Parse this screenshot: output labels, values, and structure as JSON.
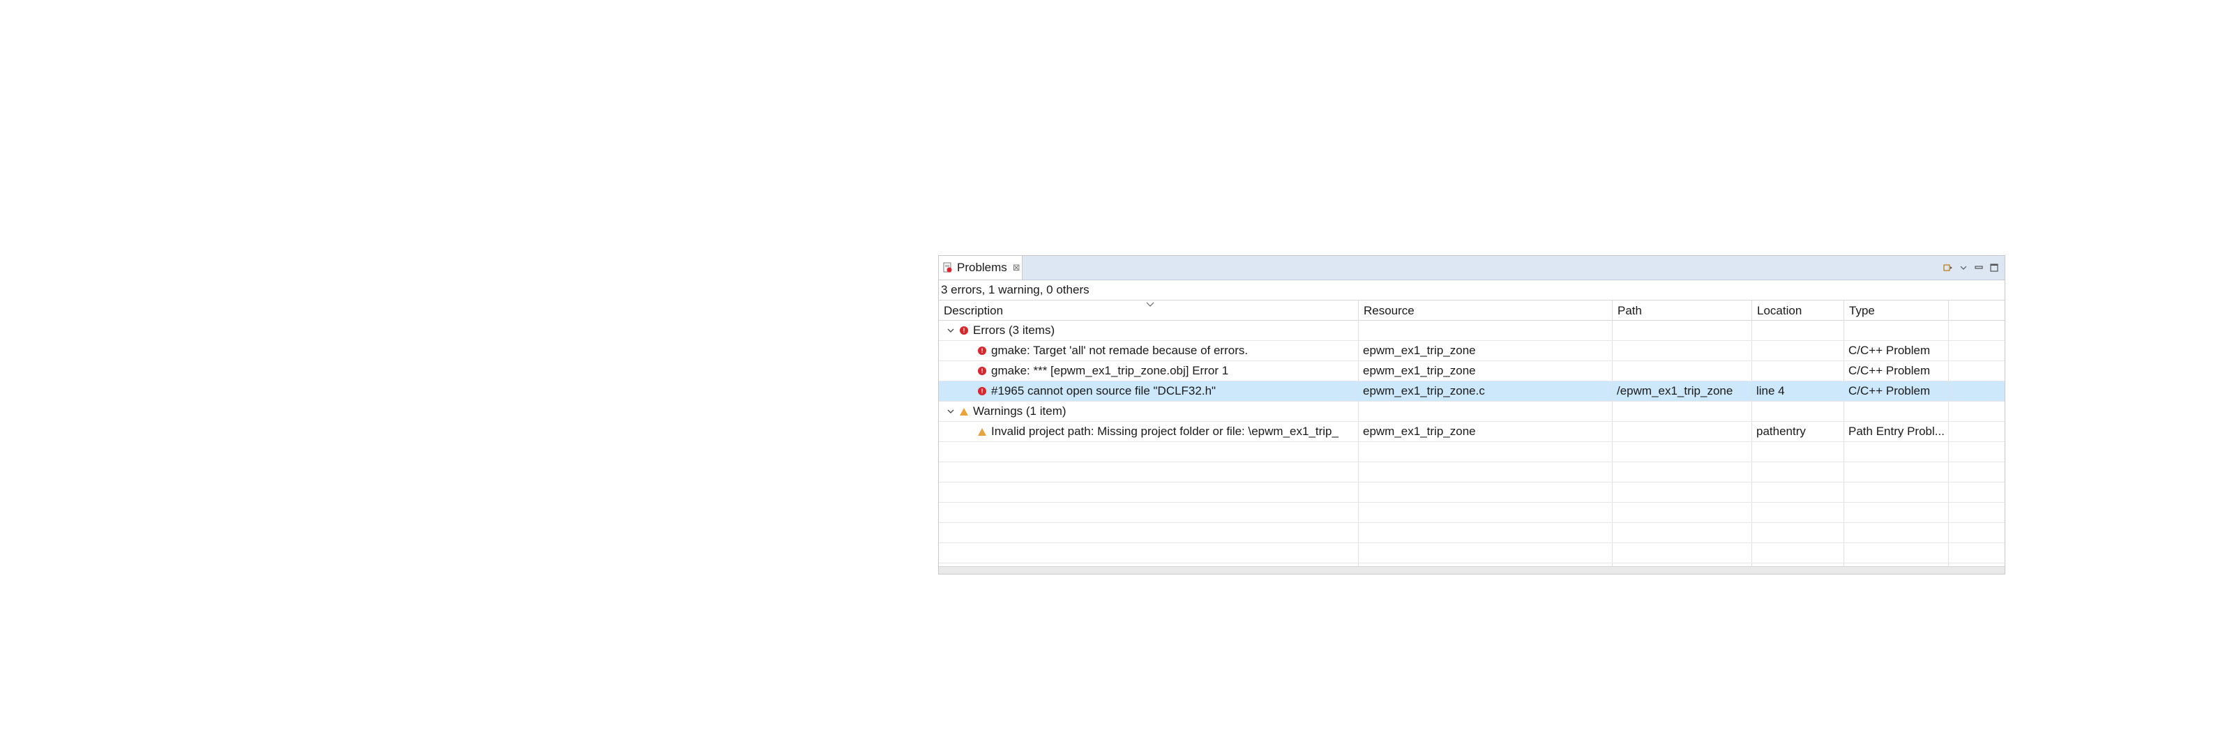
{
  "view": {
    "tab_label": "Problems",
    "tab_close": "⊠",
    "summary": "3 errors, 1 warning, 0 others"
  },
  "columns": [
    "Description",
    "Resource",
    "Path",
    "Location",
    "Type"
  ],
  "groups": [
    {
      "label": "Errors (3 items)",
      "kind": "error",
      "items": [
        {
          "description": "gmake: Target 'all' not remade because of errors.",
          "resource": "epwm_ex1_trip_zone",
          "path": "",
          "location": "",
          "type": "C/C++ Problem"
        },
        {
          "description": "gmake: *** [epwm_ex1_trip_zone.obj] Error 1",
          "resource": "epwm_ex1_trip_zone",
          "path": "",
          "location": "",
          "type": "C/C++ Problem"
        },
        {
          "description": "#1965 cannot open source file \"DCLF32.h\"",
          "resource": "epwm_ex1_trip_zone.c",
          "path": "/epwm_ex1_trip_zone",
          "location": "line 4",
          "type": "C/C++ Problem"
        }
      ]
    },
    {
      "label": "Warnings (1 item)",
      "kind": "warning",
      "items": [
        {
          "description": "Invalid project path: Missing project folder or file: \\epwm_ex1_trip_",
          "resource": "epwm_ex1_trip_zone",
          "path": "",
          "location": "pathentry",
          "type": "Path Entry Probl..."
        }
      ]
    }
  ],
  "colors": {
    "error": "#d9252c",
    "warning": "#e8a33d",
    "selection": "#cde8fb",
    "tabbar": "#dde6f3"
  },
  "icons": {
    "tab": "problems-view-icon",
    "expanded": "chevron-down-icon",
    "error": "error-icon",
    "warning": "warning-icon"
  }
}
